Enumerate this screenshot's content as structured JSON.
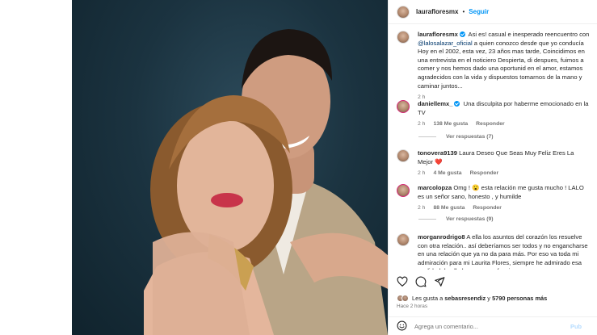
{
  "header": {
    "username": "laurafloresmx",
    "separator": "•",
    "follow_label": "Seguir"
  },
  "caption": {
    "username": "laurafloresmx",
    "text_before_mention": "Asi es! casual e inesperado reencuentro con",
    "mention": "@lalosalazar_oficial",
    "text_after_mention": "a quien conozco desde que yo conducía Hoy en el 2002, esta vez, 23 años mas tarde, Coincidimos en una entrevista en el noticiero Despierta, di despues, fuimos a comer y nos hemos dado una oportunid en el amor, estamos agradecidos con la vida y dispuestos tomarnos de la mano y caminar juntos...",
    "time": "2 h"
  },
  "comments": [
    {
      "username": "daniellemx_",
      "text": "Una disculpita por haberme emocionado en la TV",
      "time": "2 h",
      "likes": "138 Me gusta",
      "reply_label": "Responder",
      "view_replies": "Ver respuestas (7)"
    },
    {
      "username": "tonovera9139",
      "text": "Laura Deseo Que Seas Muy Feliz Eres La Mejor ❤️",
      "time": "2 h",
      "likes": "4 Me gusta",
      "reply_label": "Responder"
    },
    {
      "username": "marcolopza",
      "text": "Omg ! 😮 esta relación me gusta mucho ! LALO es un señor sano, honesto , y humilde",
      "time": "2 h",
      "likes": "88 Me gusta",
      "reply_label": "Responder",
      "view_replies": "Ver respuestas (9)"
    },
    {
      "username": "morganrodrigo8",
      "text": "A ella los asuntos del corazón los resuelve con otra relación.. así deberíamos ser todos y no engancharse en una relación que ya no da para más. Por eso va toda mi admiración para mi Laurita Flores, siempre he admirado esa cualidad de ella,lo que ya no funciona se"
    }
  ],
  "likes": {
    "prefix": "Les gusta a",
    "user": "sebasresendiz",
    "connector": "y",
    "others": "5790 personas más"
  },
  "post_time": "Hace 2 horas",
  "add_comment": {
    "placeholder": "Agrega un comentario...",
    "post_label": "Pub"
  },
  "colors": {
    "accent": "#0095f6",
    "mention": "#00376b",
    "muted": "#737373",
    "photo_background": "#1b3340"
  },
  "icons": [
    "heart-icon",
    "comment-icon",
    "share-icon",
    "emoji-icon",
    "verified-icon"
  ]
}
